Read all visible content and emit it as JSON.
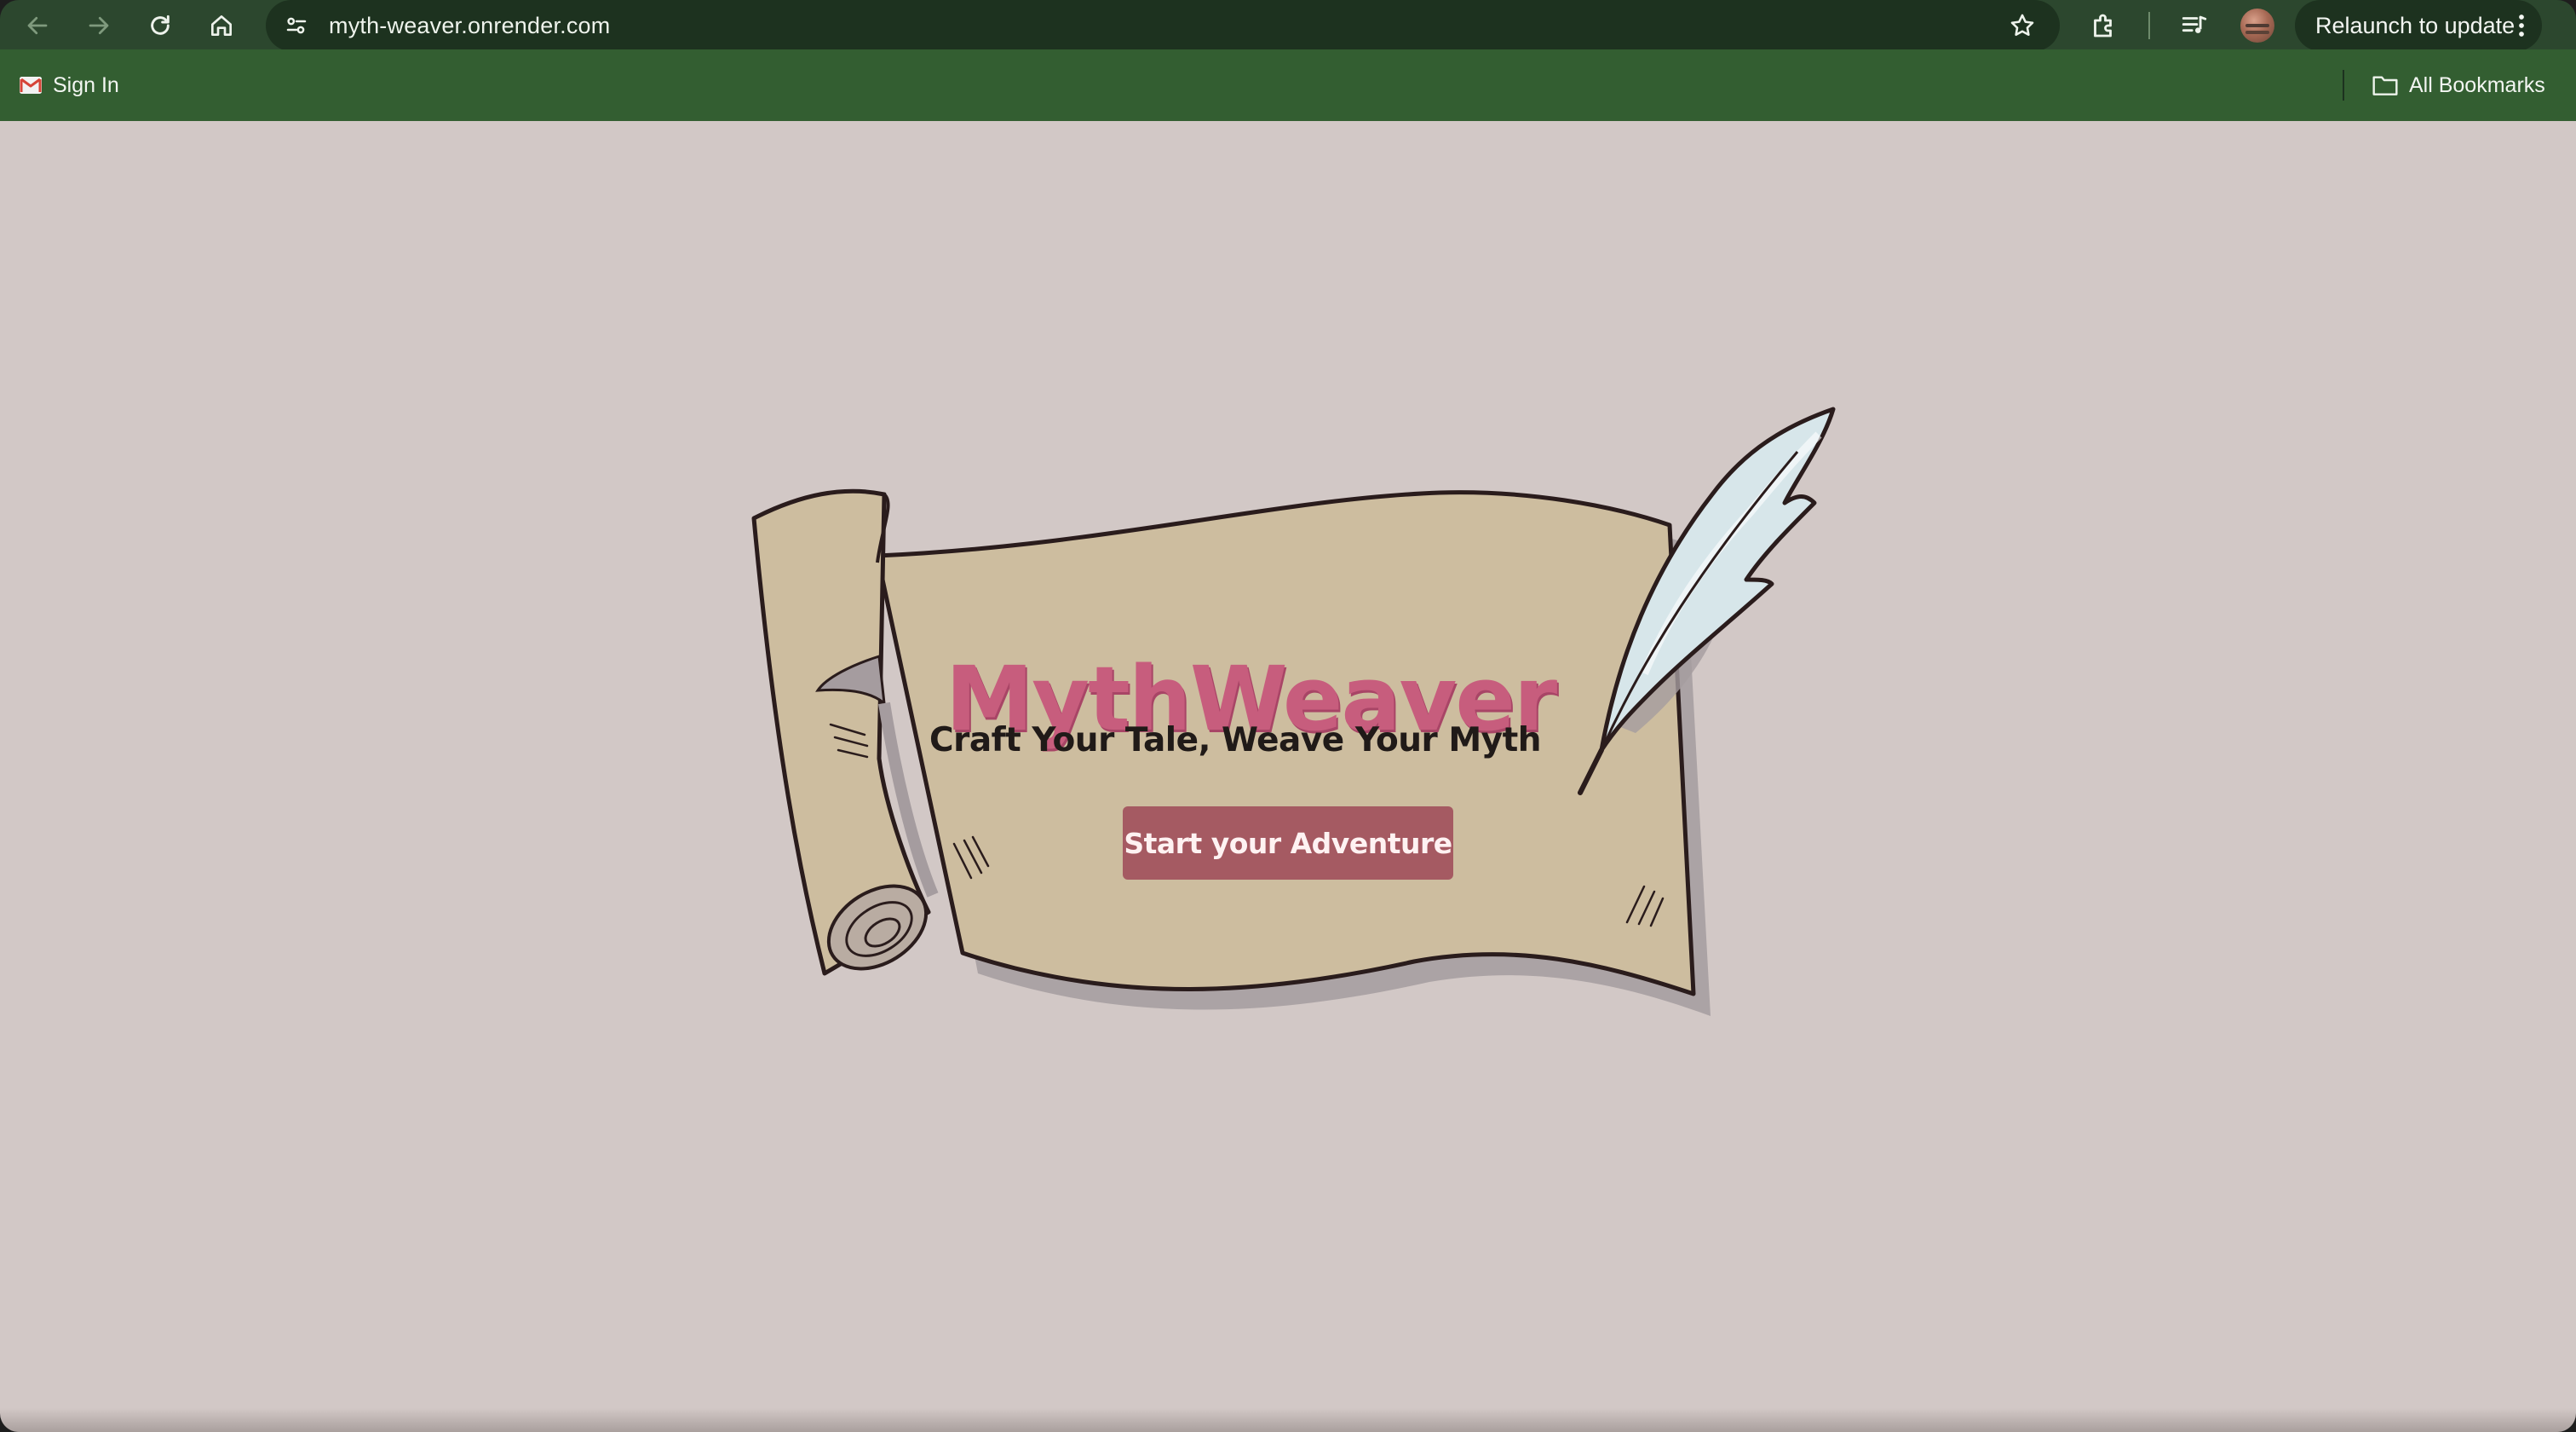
{
  "browser": {
    "url": "myth-weaver.onrender.com",
    "relaunch_label": "Relaunch to update",
    "icons": {
      "back": "arrow-left-icon",
      "forward": "arrow-right-icon",
      "reload": "reload-icon",
      "home": "home-icon",
      "site_info": "tune-icon",
      "bookmark_star": "star-icon",
      "extensions": "puzzle-icon",
      "media": "playlist-icon",
      "menu": "kebab-menu-icon"
    }
  },
  "bookmarks": {
    "items": [
      {
        "label": "Sign In",
        "icon": "gmail-icon"
      }
    ],
    "all_bookmarks": "All Bookmarks"
  },
  "page": {
    "title": "MythWeaver",
    "tagline": "Craft Your Tale, Weave Your Myth",
    "cta_label": "Start your Adventure"
  },
  "colors": {
    "toolbar": "#2c472e",
    "bookmarks_bar": "#335e31",
    "page_background": "#d2c8c6",
    "parchment": "#cfbe9f",
    "title": "#c75d7d",
    "button": "#a55a62"
  }
}
